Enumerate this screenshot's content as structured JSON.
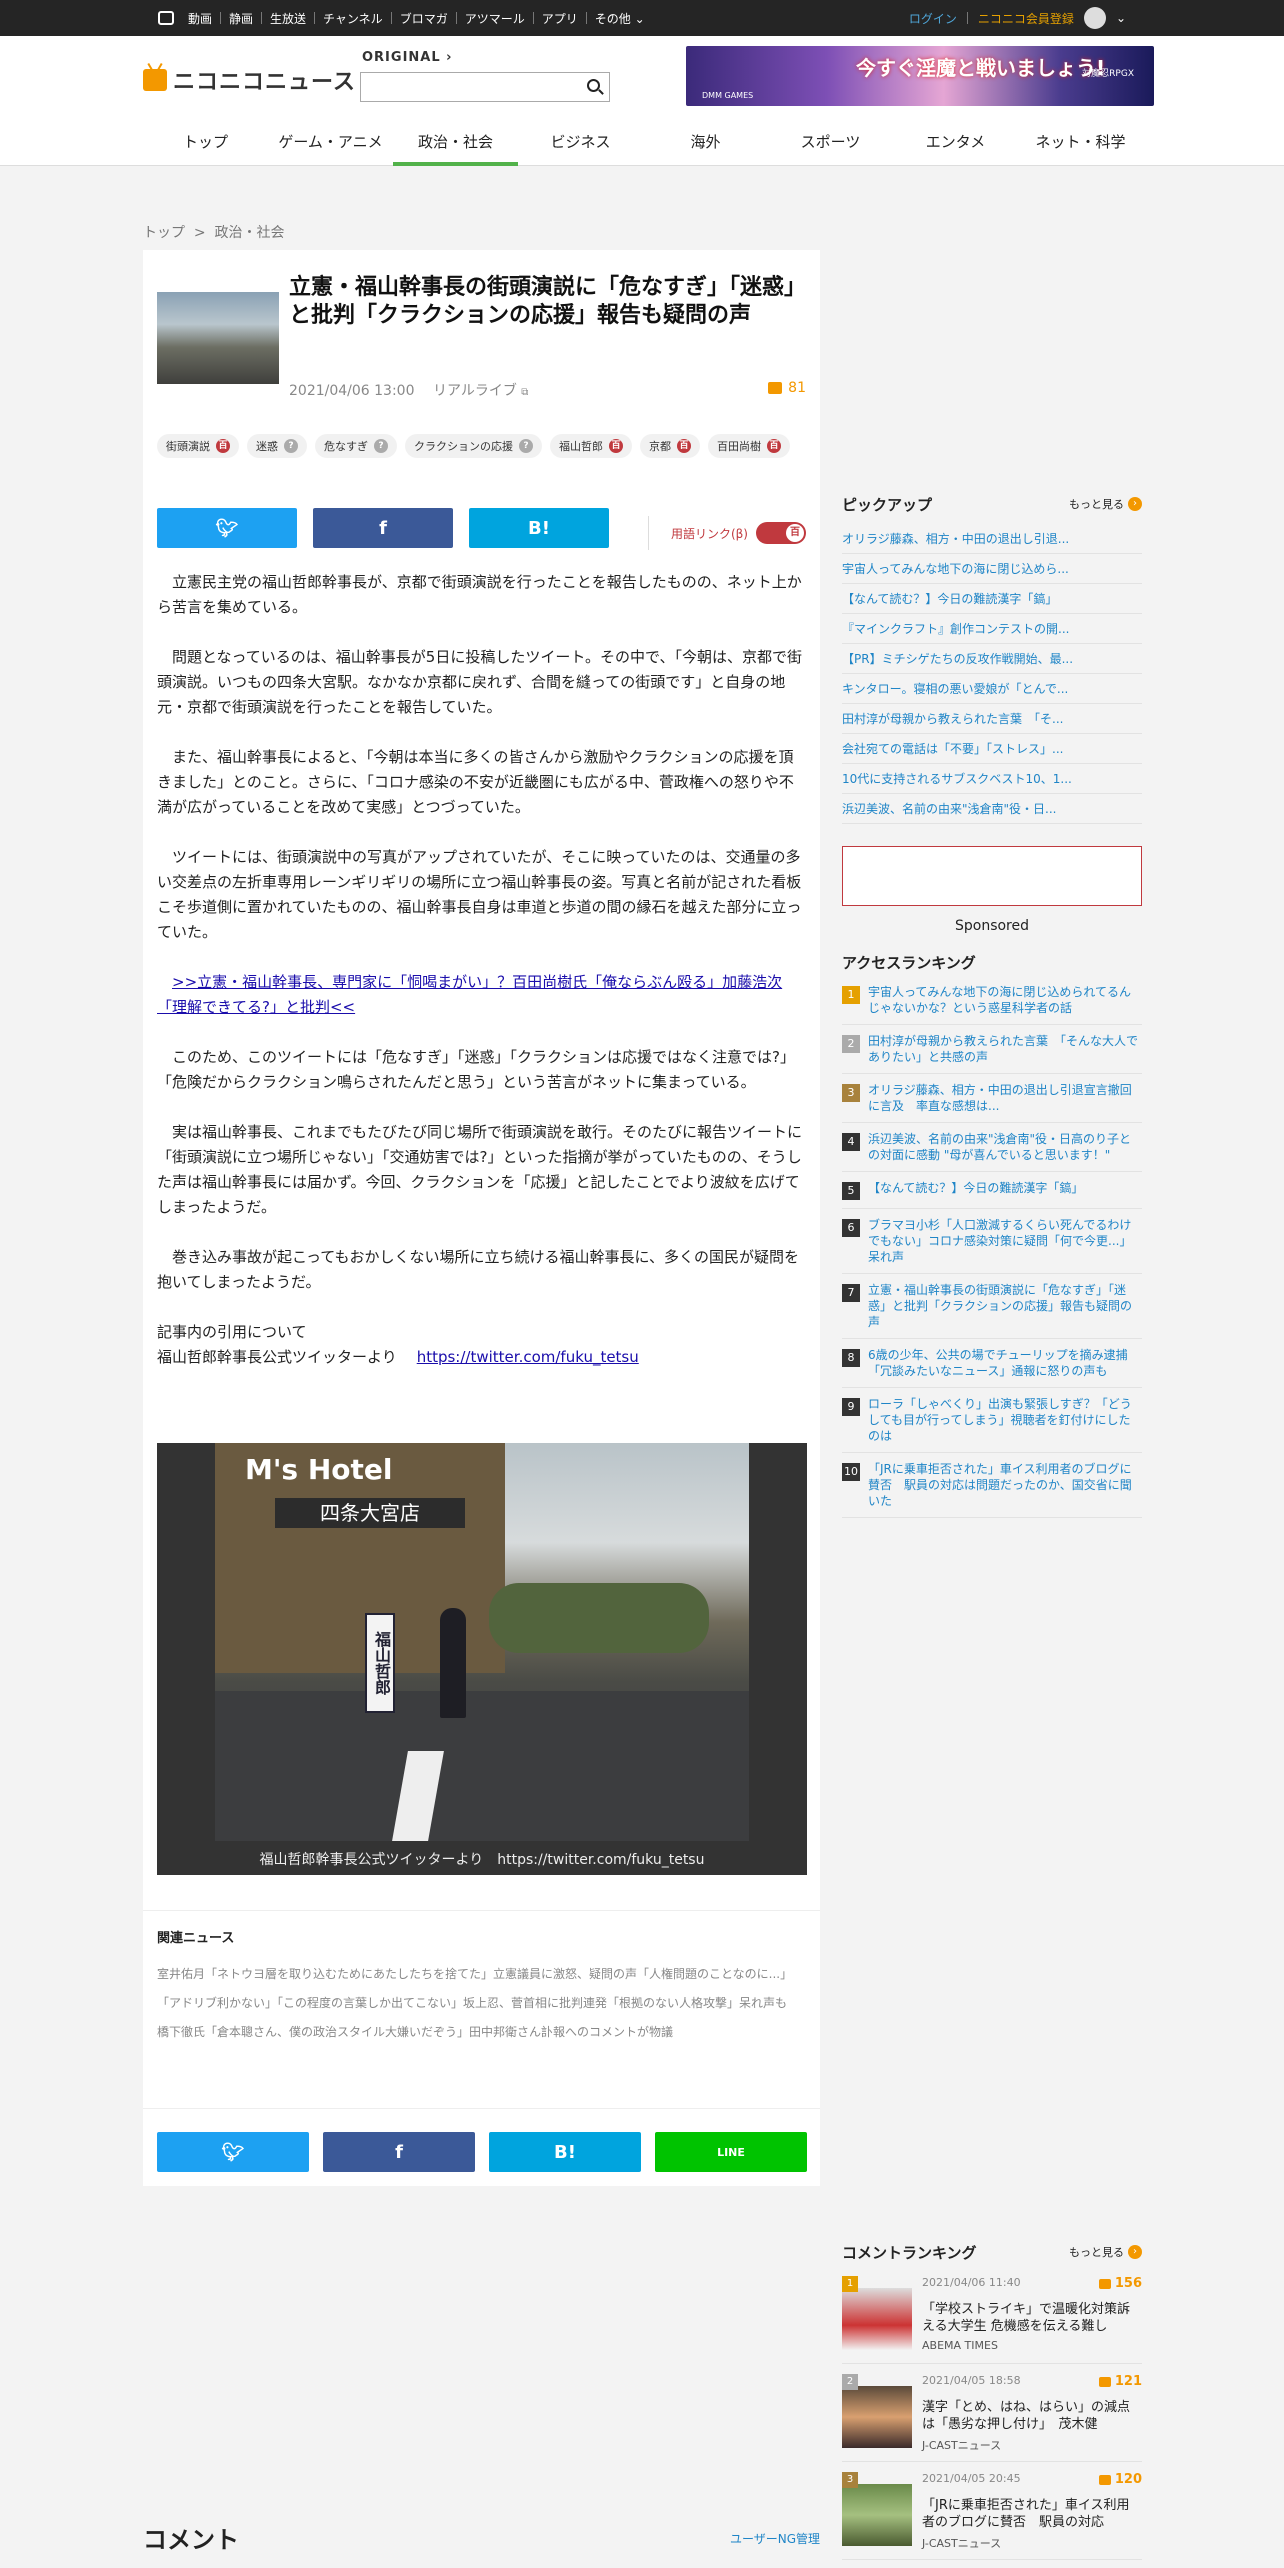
{
  "topbar": {
    "links": [
      "動画",
      "静画",
      "生放送",
      "チャンネル",
      "ブロマガ",
      "アツマール",
      "アプリ",
      "その他"
    ],
    "login": "ログイン",
    "register": "ニコニコ会員登録"
  },
  "header": {
    "logo": "ニコニコニュース",
    "original_label": "ORIGINAL",
    "search_placeholder": "",
    "ad": {
      "main_text": "今すぐ淫魔と戦いましょう!",
      "small_left": "DMM GAMES",
      "small_right": "対魔忍RPGX"
    }
  },
  "nav": [
    "トップ",
    "ゲーム・アニメ",
    "政治・社会",
    "ビジネス",
    "海外",
    "スポーツ",
    "エンタメ",
    "ネット・科学"
  ],
  "nav_active": "政治・社会",
  "breadcrumb": {
    "home": "トップ",
    "sep": ">",
    "current": "政治・社会"
  },
  "article": {
    "title": "立憲・福山幹事長の街頭演説に「危なすぎ」「迷惑」と批判「クラクションの応援」報告も疑問の声",
    "date": "2021/04/06 13:00",
    "source": "リアルライブ",
    "comment_count": "81",
    "tags": [
      {
        "label": "街頭演説",
        "mark": "百",
        "mark_type": "r"
      },
      {
        "label": "迷惑",
        "mark": "?",
        "mark_type": "g"
      },
      {
        "label": "危なすぎ",
        "mark": "?",
        "mark_type": "g"
      },
      {
        "label": "クラクションの応援",
        "mark": "?",
        "mark_type": "g"
      },
      {
        "label": "福山哲郎",
        "mark": "百",
        "mark_type": "r"
      },
      {
        "label": "京都",
        "mark": "百",
        "mark_type": "r"
      },
      {
        "label": "百田尚樹",
        "mark": "百",
        "mark_type": "r"
      }
    ],
    "share": {
      "twitter": "",
      "facebook": "f",
      "hatena": "B!",
      "line": "LINE"
    },
    "glossary_label": "用語リンク(β)",
    "paragraphs": [
      "立憲民主党の福山哲郎幹事長が、京都で街頭演説を行ったことを報告したものの、ネット上から苦言を集めている。",
      "問題となっているのは、福山幹事長が5日に投稿したツイート。その中で、「今朝は、京都で街頭演説。いつもの四条大宮駅。なかなか京都に戻れず、合間を縫っての街頭です」と自身の地元・京都で街頭演説を行ったことを報告していた。",
      "また、福山幹事長によると、「今朝は本当に多くの皆さんから激励やクラクションの応援を頂きました」とのこと。さらに、「コロナ感染の不安が近畿圏にも広がる中、菅政権への怒りや不満が広がっていることを改めて実感」とつづっていた。",
      "ツイートには、街頭演説中の写真がアップされていたが、そこに映っていたのは、交通量の多い交差点の左折車専用レーンギリギリの場所に立つ福山幹事長の姿。写真と名前が記された看板こそ歩道側に置かれていたものの、福山幹事長自身は車道と歩道の間の縁石を越えた部分に立っていた。"
    ],
    "link_text": ">>立憲・福山幹事長、専門家に「恫喝まがい」？百田尚樹氏「俺ならぶん殴る」加藤浩次「理解できてる?」と批判<<",
    "paragraphs2": [
      "このため、このツイートには「危なすぎ」「迷惑」「クラクションは応援ではなく注意では?」「危険だからクラクション鳴らされたんだと思う」という苦言がネットに集まっている。",
      "実は福山幹事長、これまでもたびたび同じ場所で街頭演説を敢行。そのたびに報告ツイートに「街頭演説に立つ場所じゃない」「交通妨害では?」といった指摘が挙がっていたものの、そうした声は福山幹事長には届かず。今回、クラクションを「応援」と記したことでより波紋を広げてしまったようだ。",
      "巻き込み事故が起こってもおかしくない場所に立ち続ける福山幹事長に、多くの国民が疑問を抱いてしまったようだ。"
    ],
    "cite_label": "記事内の引用について",
    "cite_source": "福山哲郎幹事長公式ツイッターより",
    "cite_url": "https://twitter.com/fuku_tetsu",
    "photo": {
      "caption": "福山哲郎幹事長公式ツイッターより　https://twitter.com/fuku_tetsu",
      "sign_text": "M's Hotel",
      "store_text": "四条大宮店",
      "banner_text": "福山哲郎"
    },
    "related_title": "関連ニュース",
    "related": [
      "室井佑月「ネトウヨ層を取り込むためにあたしたちを捨てた」立憲議員に激怒、疑問の声「人権問題のことなのに...」",
      "「アドリブ利かない」「この程度の言葉しか出てこない」坂上忍、菅首相に批判連発「根拠のない人格攻撃」呆れ声も",
      "橋下徹氏「倉本聰さん、僕の政治スタイル大嫌いだぞう」田中邦衛さん訃報へのコメントが物議"
    ]
  },
  "sidebar": {
    "pickup_title": "ピックアップ",
    "more_label": "もっと見る",
    "pickup": [
      "オリラジ藤森、相方・中田の退出し引退...",
      "宇宙人ってみんな地下の海に閉じ込めら...",
      "【なんて読む？】今日の難読漢字「鎬」",
      "『マインクラフト』創作コンテストの開...",
      "【PR】ミチシゲたちの反攻作戦開始、最...",
      "キンタロー。寝相の悪い愛娘が「とんで...",
      "田村淳が母親から教えられた言葉　「そ...",
      "会社宛ての電話は「不要」「ストレス」...",
      "10代に支持されるサブスクベスト10、1...",
      "浜辺美波、名前の由来\"浅倉南\"役・日..."
    ],
    "sponsored": "Sponsored",
    "ranking_title": "アクセスランキング",
    "ranking": [
      "宇宙人ってみんな地下の海に閉じ込められてるんじゃないかな？という惑星科学者の話",
      "田村淳が母親から教えられた言葉　「そんな大人でありたい」と共感の声",
      "オリラジ藤森、相方・中田の退出し引退宣言撤回に言及　率直な感想は...",
      "浜辺美波、名前の由来\"浅倉南\"役・日高のり子との対面に感動 \"母が喜んでいると思います！\"",
      "【なんて読む？】今日の難読漢字「鎬」",
      "ブラマヨ小杉「人口激減するくらい死んでるわけでもない」コロナ感染対策に疑問「何で今更...」呆れ声",
      "立憲・福山幹事長の街頭演説に「危なすぎ」「迷惑」と批判「クラクションの応援」報告も疑問の声",
      "6歳の少年、公共の場でチューリップを摘み逮捕「冗談みたいなニュース」通報に怒りの声も",
      "ローラ「しゃべくり」出演も緊張しすぎ？「どうしても目が行ってしまう」視聴者を釘付けにしたのは",
      "「JRに乗車拒否された」車イス利用者のブログに賛否　駅員の対応は問題だったのか、国交省に聞いた"
    ],
    "comment_ranking_title": "コメントランキング",
    "comment_ranking": [
      {
        "date": "2021/04/06 11:40",
        "count": "156",
        "title": "「学校ストライキ」で温暖化対策訴える大学生 危機感を伝える難し",
        "source": "ABEMA TIMES"
      },
      {
        "date": "2021/04/05 18:58",
        "count": "121",
        "title": "漢字「とめ、はね、はらい」の減点は「愚劣な押し付け」　茂木健",
        "source": "J-CASTニュース"
      },
      {
        "date": "2021/04/05 20:45",
        "count": "120",
        "title": "「JRに乗車拒否された」車イス利用者のブログに賛否　駅員の対応",
        "source": "J-CASTニュース"
      }
    ]
  },
  "comments": {
    "title": "コメント",
    "ng_label": "ユーザーNG管理"
  }
}
